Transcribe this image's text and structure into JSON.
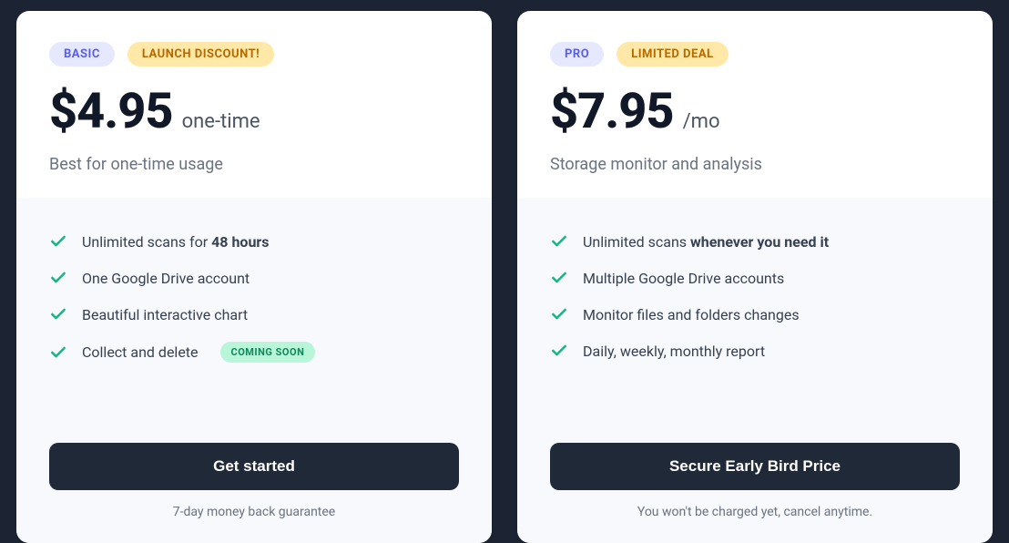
{
  "plans": [
    {
      "key": "basic",
      "name": "BASIC",
      "promo": "LAUNCH DISCOUNT!",
      "price": "$4.95",
      "period": "one-time",
      "desc": "Best for one-time usage",
      "features": [
        {
          "prefix": "Unlimited scans for ",
          "bold": "48 hours",
          "soon": null
        },
        {
          "text": "One Google Drive account",
          "soon": null
        },
        {
          "text": "Beautiful interactive chart",
          "soon": null
        },
        {
          "text": "Collect and delete",
          "soon": "COMING SOON"
        }
      ],
      "cta": "Get started",
      "footnote": "7-day money back guarantee"
    },
    {
      "key": "pro",
      "name": "PRO",
      "promo": "LIMITED DEAL",
      "price": "$7.95",
      "period": "/mo",
      "desc": "Storage monitor and analysis",
      "features": [
        {
          "prefix": "Unlimited scans ",
          "bold": "whenever you need it",
          "soon": null
        },
        {
          "text": "Multiple Google Drive accounts",
          "soon": null
        },
        {
          "text": "Monitor files and folders changes",
          "soon": null
        },
        {
          "text": "Daily, weekly, monthly report",
          "soon": null
        }
      ],
      "cta": "Secure Early Bird Price",
      "footnote": "You won't be charged yet, cancel anytime."
    }
  ]
}
